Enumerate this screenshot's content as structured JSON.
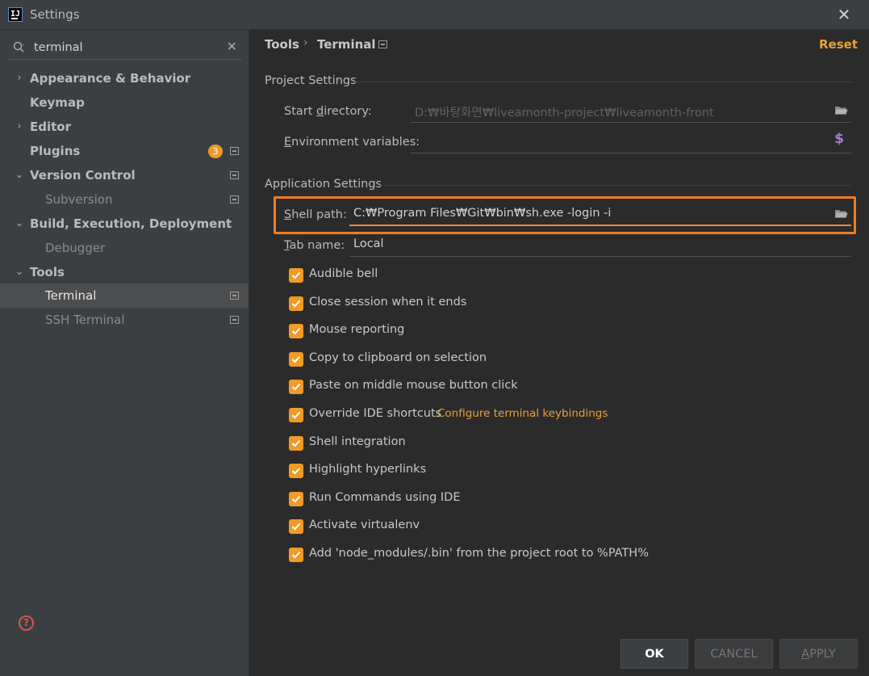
{
  "window": {
    "title": "Settings",
    "logo_text": "IJ"
  },
  "sidebar": {
    "search_value": "terminal",
    "items": [
      {
        "label": "Appearance & Behavior"
      },
      {
        "label": "Keymap"
      },
      {
        "label": "Editor"
      },
      {
        "label": "Plugins",
        "badge": "3"
      },
      {
        "label": "Version Control"
      },
      {
        "label": "Subversion"
      },
      {
        "label": "Build, Execution, Deployment"
      },
      {
        "label": "Debugger"
      },
      {
        "label": "Tools"
      },
      {
        "label": "Terminal"
      },
      {
        "label": "SSH Terminal"
      }
    ],
    "help": "?"
  },
  "header": {
    "breadcrumb_parent": "Tools",
    "breadcrumb_separator": "›",
    "breadcrumb_current": "Terminal",
    "reset": "Reset"
  },
  "project_settings": {
    "title": "Project Settings",
    "start_directory_label_pre": "Start ",
    "start_directory_label_u": "d",
    "start_directory_label_post": "irectory:",
    "start_directory_value": "D:₩바탕화면₩liveamonth-project₩liveamonth-front",
    "env_label_u": "E",
    "env_label_post": "nvironment variables:",
    "env_value": ""
  },
  "app_settings": {
    "title": "Application Settings",
    "shell_path_label_u": "S",
    "shell_path_label_post": "hell path:",
    "shell_path_value": "C:₩Program Files₩Git₩bin₩sh.exe -login -i",
    "tab_name_label_u": "T",
    "tab_name_label_post": "ab name:",
    "tab_name_value": "Local"
  },
  "checkboxes": [
    {
      "label": "Audible bell",
      "checked": true
    },
    {
      "label": "Close session when it ends",
      "checked": true
    },
    {
      "label": "Mouse reporting",
      "checked": true
    },
    {
      "label": "Copy to clipboard on selection",
      "checked": true
    },
    {
      "label": "Paste on middle mouse button click",
      "checked": true
    },
    {
      "label": "Override IDE shortcuts",
      "checked": true
    },
    {
      "label": "Shell integration",
      "checked": true
    },
    {
      "label": "Highlight hyperlinks",
      "checked": true
    },
    {
      "label": "Run Commands using IDE",
      "checked": true
    },
    {
      "label": "Activate virtualenv",
      "checked": true
    },
    {
      "label": "Add 'node_modules/.bin' from the project root to %PATH%",
      "checked": true
    }
  ],
  "configure_link": "Configure terminal keybindings",
  "buttons": {
    "ok": "OK",
    "cancel": "CANCEL",
    "apply_u": "A",
    "apply_post": "PPLY"
  },
  "colors": {
    "accent": "#f19a25",
    "link": "#e5a03b",
    "highlight_border": "#f07c20",
    "background": "#2b2b2b",
    "sidebar": "#3c3f41"
  }
}
